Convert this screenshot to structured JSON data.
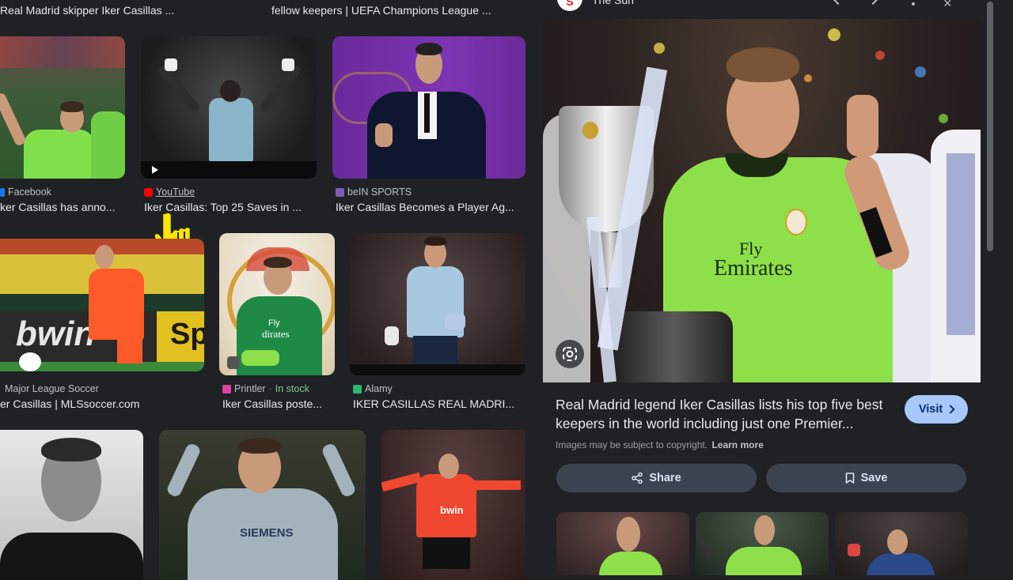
{
  "top_captions": [
    "Real Madrid skipper Iker Casillas ...",
    "fellow keepers | UEFA Champions League ..."
  ],
  "row1": [
    {
      "source": "Facebook",
      "title": "ker Casillas has anno...",
      "fav_color": "#1877f2"
    },
    {
      "source": "YouTube",
      "title": "Iker Casillas: Top 25 Saves in ...",
      "fav_color": "#ff0000"
    },
    {
      "source": "beIN SPORTS",
      "title": "Iker Casillas Becomes a Player Ag...",
      "fav_color": "#7b5cb8"
    }
  ],
  "row2": [
    {
      "source": "Major League Soccer",
      "title": "er Casillas | MLSsoccer.com"
    },
    {
      "source": "Printler",
      "stock": "In stock",
      "title": "Iker Casillas poste...",
      "fav_color": "#e040a0"
    },
    {
      "source": "Alamy",
      "title": "IKER CASILLAS REAL MADRI...",
      "fav_color": "#2bb673"
    }
  ],
  "image_text": {
    "bwin": "bwin",
    "sp": "Sp",
    "fly": "Fly",
    "emirates": "Emirates",
    "dirates": "dirates",
    "siemens": "SIEMENS",
    "bwin_shirt": "bwin"
  },
  "panel": {
    "source_name": "The Sun",
    "source_logo": "S",
    "shirt_fly": "Fly",
    "shirt_emirates": "Emirates",
    "headline": "Real Madrid legend Iker Casillas lists his top five best keepers in the world including just one Premier...",
    "copyright_note": "Images may be subject to copyright.",
    "learn_more": "Learn more",
    "visit_label": "Visit",
    "share_label": "Share",
    "save_label": "Save"
  },
  "colors": {
    "background": "#202124",
    "visit_button": "#a8c7fa",
    "action_button": "#3c4350",
    "in_stock": "#81c995",
    "jersey_green": "#8de04a"
  },
  "icons": [
    "play-icon",
    "youtube-icon",
    "hand-cursor-icon",
    "lens-icon",
    "share-icon",
    "bookmark-icon",
    "chevron-right-icon",
    "close-icon",
    "more-vert-icon",
    "arrow-left-icon",
    "arrow-right-icon"
  ]
}
